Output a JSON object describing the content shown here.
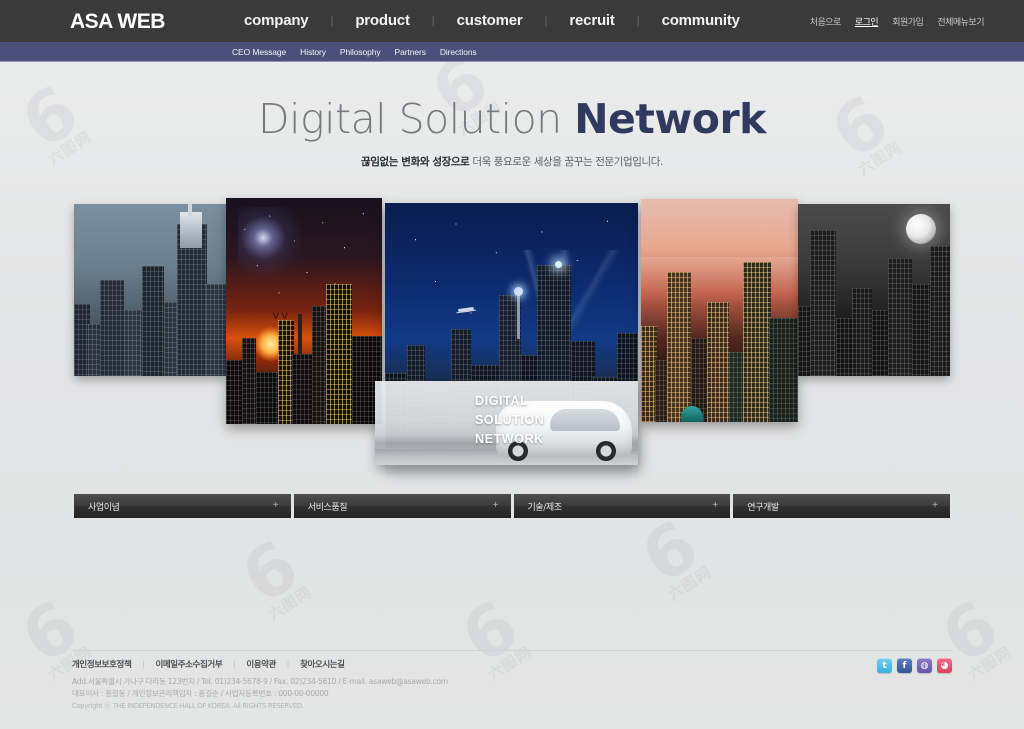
{
  "header": {
    "logo": "ASA WEB",
    "nav": [
      {
        "label": "company"
      },
      {
        "label": "product"
      },
      {
        "label": "customer"
      },
      {
        "label": "recruit"
      },
      {
        "label": "community"
      }
    ],
    "util": [
      {
        "label": "처음으로",
        "active": false
      },
      {
        "label": "로그인",
        "active": true
      },
      {
        "label": "회원가입",
        "active": false
      },
      {
        "label": "전체메뉴보기",
        "active": false
      }
    ],
    "subnav": [
      {
        "label": "CEO Message"
      },
      {
        "label": "History"
      },
      {
        "label": "Philosophy"
      },
      {
        "label": "Partners"
      },
      {
        "label": "Directions"
      }
    ],
    "colors": {
      "topbar": "#3a3a3b",
      "subbar": "#4a5079"
    }
  },
  "hero": {
    "title_light": "Digital Solution",
    "title_bold": "Network",
    "subtitle_bold": "끊임없는 변화와 성장으로",
    "subtitle_rest": " 더욱 풍요로운 세상을 꿈꾸는 전문기업입니다."
  },
  "gallery": {
    "panels": [
      {
        "id": "p1",
        "name": "blue-grey-skyscrapers"
      },
      {
        "id": "p2",
        "name": "starry-sunset-city"
      },
      {
        "id": "p3",
        "name": "deep-blue-night-city"
      },
      {
        "id": "p4",
        "name": "warm-sunset-city"
      },
      {
        "id": "p5",
        "name": "moonlit-monochrome-city"
      }
    ],
    "overlay": {
      "line1": "DIGITAL",
      "line2": "SOLUTION",
      "line3": "NETWORK"
    }
  },
  "quicklinks": [
    {
      "label": "사업이념",
      "plus": "+"
    },
    {
      "label": "서비스품질",
      "plus": "+"
    },
    {
      "label": "기술/제조",
      "plus": "+"
    },
    {
      "label": "연구개발",
      "plus": "+"
    }
  ],
  "footer": {
    "links": [
      {
        "label": "개인정보보호정책"
      },
      {
        "label": "이메일주소수집거부"
      },
      {
        "label": "이용약관"
      },
      {
        "label": "찾아오시는길"
      }
    ],
    "separator": "|",
    "address": "Add.서울특별시 가나구 다라동 123번지 / Tel. 01)234-5678-9 / Fax. 02)234-5610 / E-mail. asaweb@asaweb.com",
    "company": "대표이사 : 홍길동 / 개인정보관리책임자 : 홍길순 / 사업자등록번호 : 000-00-00000",
    "copyright": "Copyright ⓒ THE INDEPENDENCE HALL OF KOREA. All RIGHTS RESERVED.",
    "socials": [
      {
        "name": "twitter-icon",
        "glyph": "t"
      },
      {
        "name": "facebook-icon",
        "glyph": "f"
      },
      {
        "name": "me2day-icon",
        "glyph": "◍"
      },
      {
        "name": "cyworld-icon",
        "glyph": "◕"
      }
    ]
  },
  "watermark": {
    "mark": "6",
    "text": "六图网"
  }
}
